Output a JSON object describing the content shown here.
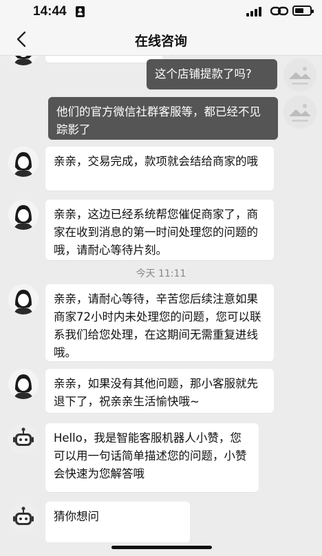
{
  "status_bar": {
    "time": "14:44"
  },
  "header": {
    "title": "在线咨询"
  },
  "chat": {
    "timestamp": "今天 11:11",
    "messages": [
      {
        "sender": "user",
        "avatar": "image-placeholder-icon",
        "text": "这个店铺提款了吗?"
      },
      {
        "sender": "user",
        "avatar": "image-placeholder-icon",
        "text": "他们的官方微信社群客服等，都已经不见踪影了"
      },
      {
        "sender": "agent",
        "avatar": "agent-avatar-icon",
        "text": "亲亲，交易完成，款项就会结给商家的哦"
      },
      {
        "sender": "agent",
        "avatar": "agent-avatar-icon",
        "text": "亲亲，这边已经系统帮您催促商家了，商家在收到消息的第一时间处理您的问题的哦，请耐心等待片刻。"
      },
      {
        "sender": "agent",
        "avatar": "agent-avatar-icon",
        "text": "亲亲，请耐心等待，辛苦您后续注意如果商家72小时内未处理您的问题，您可以联系我们给您处理，在这期间无需重复进线哦。"
      },
      {
        "sender": "agent",
        "avatar": "agent-avatar-icon",
        "text": "亲亲，如果没有其他问题，那小客服就先退下了，祝亲亲生活愉快哦~"
      },
      {
        "sender": "bot",
        "avatar": "robot-avatar-icon",
        "text": "Hello，我是智能客服机器人小赞，您可以用一句话简单描述您的问题，小赞会快速为您解答哦"
      },
      {
        "sender": "bot",
        "avatar": "robot-avatar-icon",
        "text": "猜你想问"
      }
    ]
  },
  "colors": {
    "background": "#ececec",
    "sent_bubble": "#555555",
    "received_bubble": "#ffffff"
  }
}
